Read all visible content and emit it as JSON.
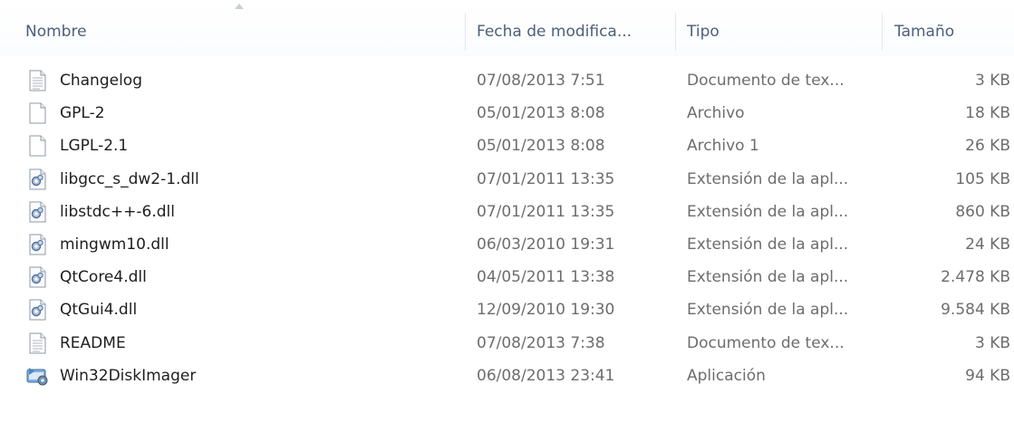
{
  "columns": {
    "name": "Nombre",
    "date": "Fecha de modifica...",
    "type": "Tipo",
    "size": "Tamaño"
  },
  "files": [
    {
      "name": "Changelog",
      "date": "07/08/2013 7:51",
      "type": "Documento de tex...",
      "size": "3 KB",
      "icon": "text-document-icon"
    },
    {
      "name": "GPL-2",
      "date": "05/01/2013 8:08",
      "type": "Archivo",
      "size": "18 KB",
      "icon": "blank-file-icon"
    },
    {
      "name": "LGPL-2.1",
      "date": "05/01/2013 8:08",
      "type": "Archivo 1",
      "size": "26 KB",
      "icon": "blank-file-icon"
    },
    {
      "name": "libgcc_s_dw2-1.dll",
      "date": "07/01/2011 13:35",
      "type": "Extensión de la apl...",
      "size": "105 KB",
      "icon": "dll-file-icon"
    },
    {
      "name": "libstdc++-6.dll",
      "date": "07/01/2011 13:35",
      "type": "Extensión de la apl...",
      "size": "860 KB",
      "icon": "dll-file-icon"
    },
    {
      "name": "mingwm10.dll",
      "date": "06/03/2010 19:31",
      "type": "Extensión de la apl...",
      "size": "24 KB",
      "icon": "dll-file-icon"
    },
    {
      "name": "QtCore4.dll",
      "date": "04/05/2011 13:38",
      "type": "Extensión de la apl...",
      "size": "2.478 KB",
      "icon": "dll-file-icon"
    },
    {
      "name": "QtGui4.dll",
      "date": "12/09/2010 19:30",
      "type": "Extensión de la apl...",
      "size": "9.584 KB",
      "icon": "dll-file-icon"
    },
    {
      "name": "README",
      "date": "07/08/2013 7:38",
      "type": "Documento de tex...",
      "size": "3 KB",
      "icon": "text-document-icon"
    },
    {
      "name": "Win32DiskImager",
      "date": "06/08/2013 23:41",
      "type": "Aplicación",
      "size": "94 KB",
      "icon": "application-icon"
    }
  ]
}
